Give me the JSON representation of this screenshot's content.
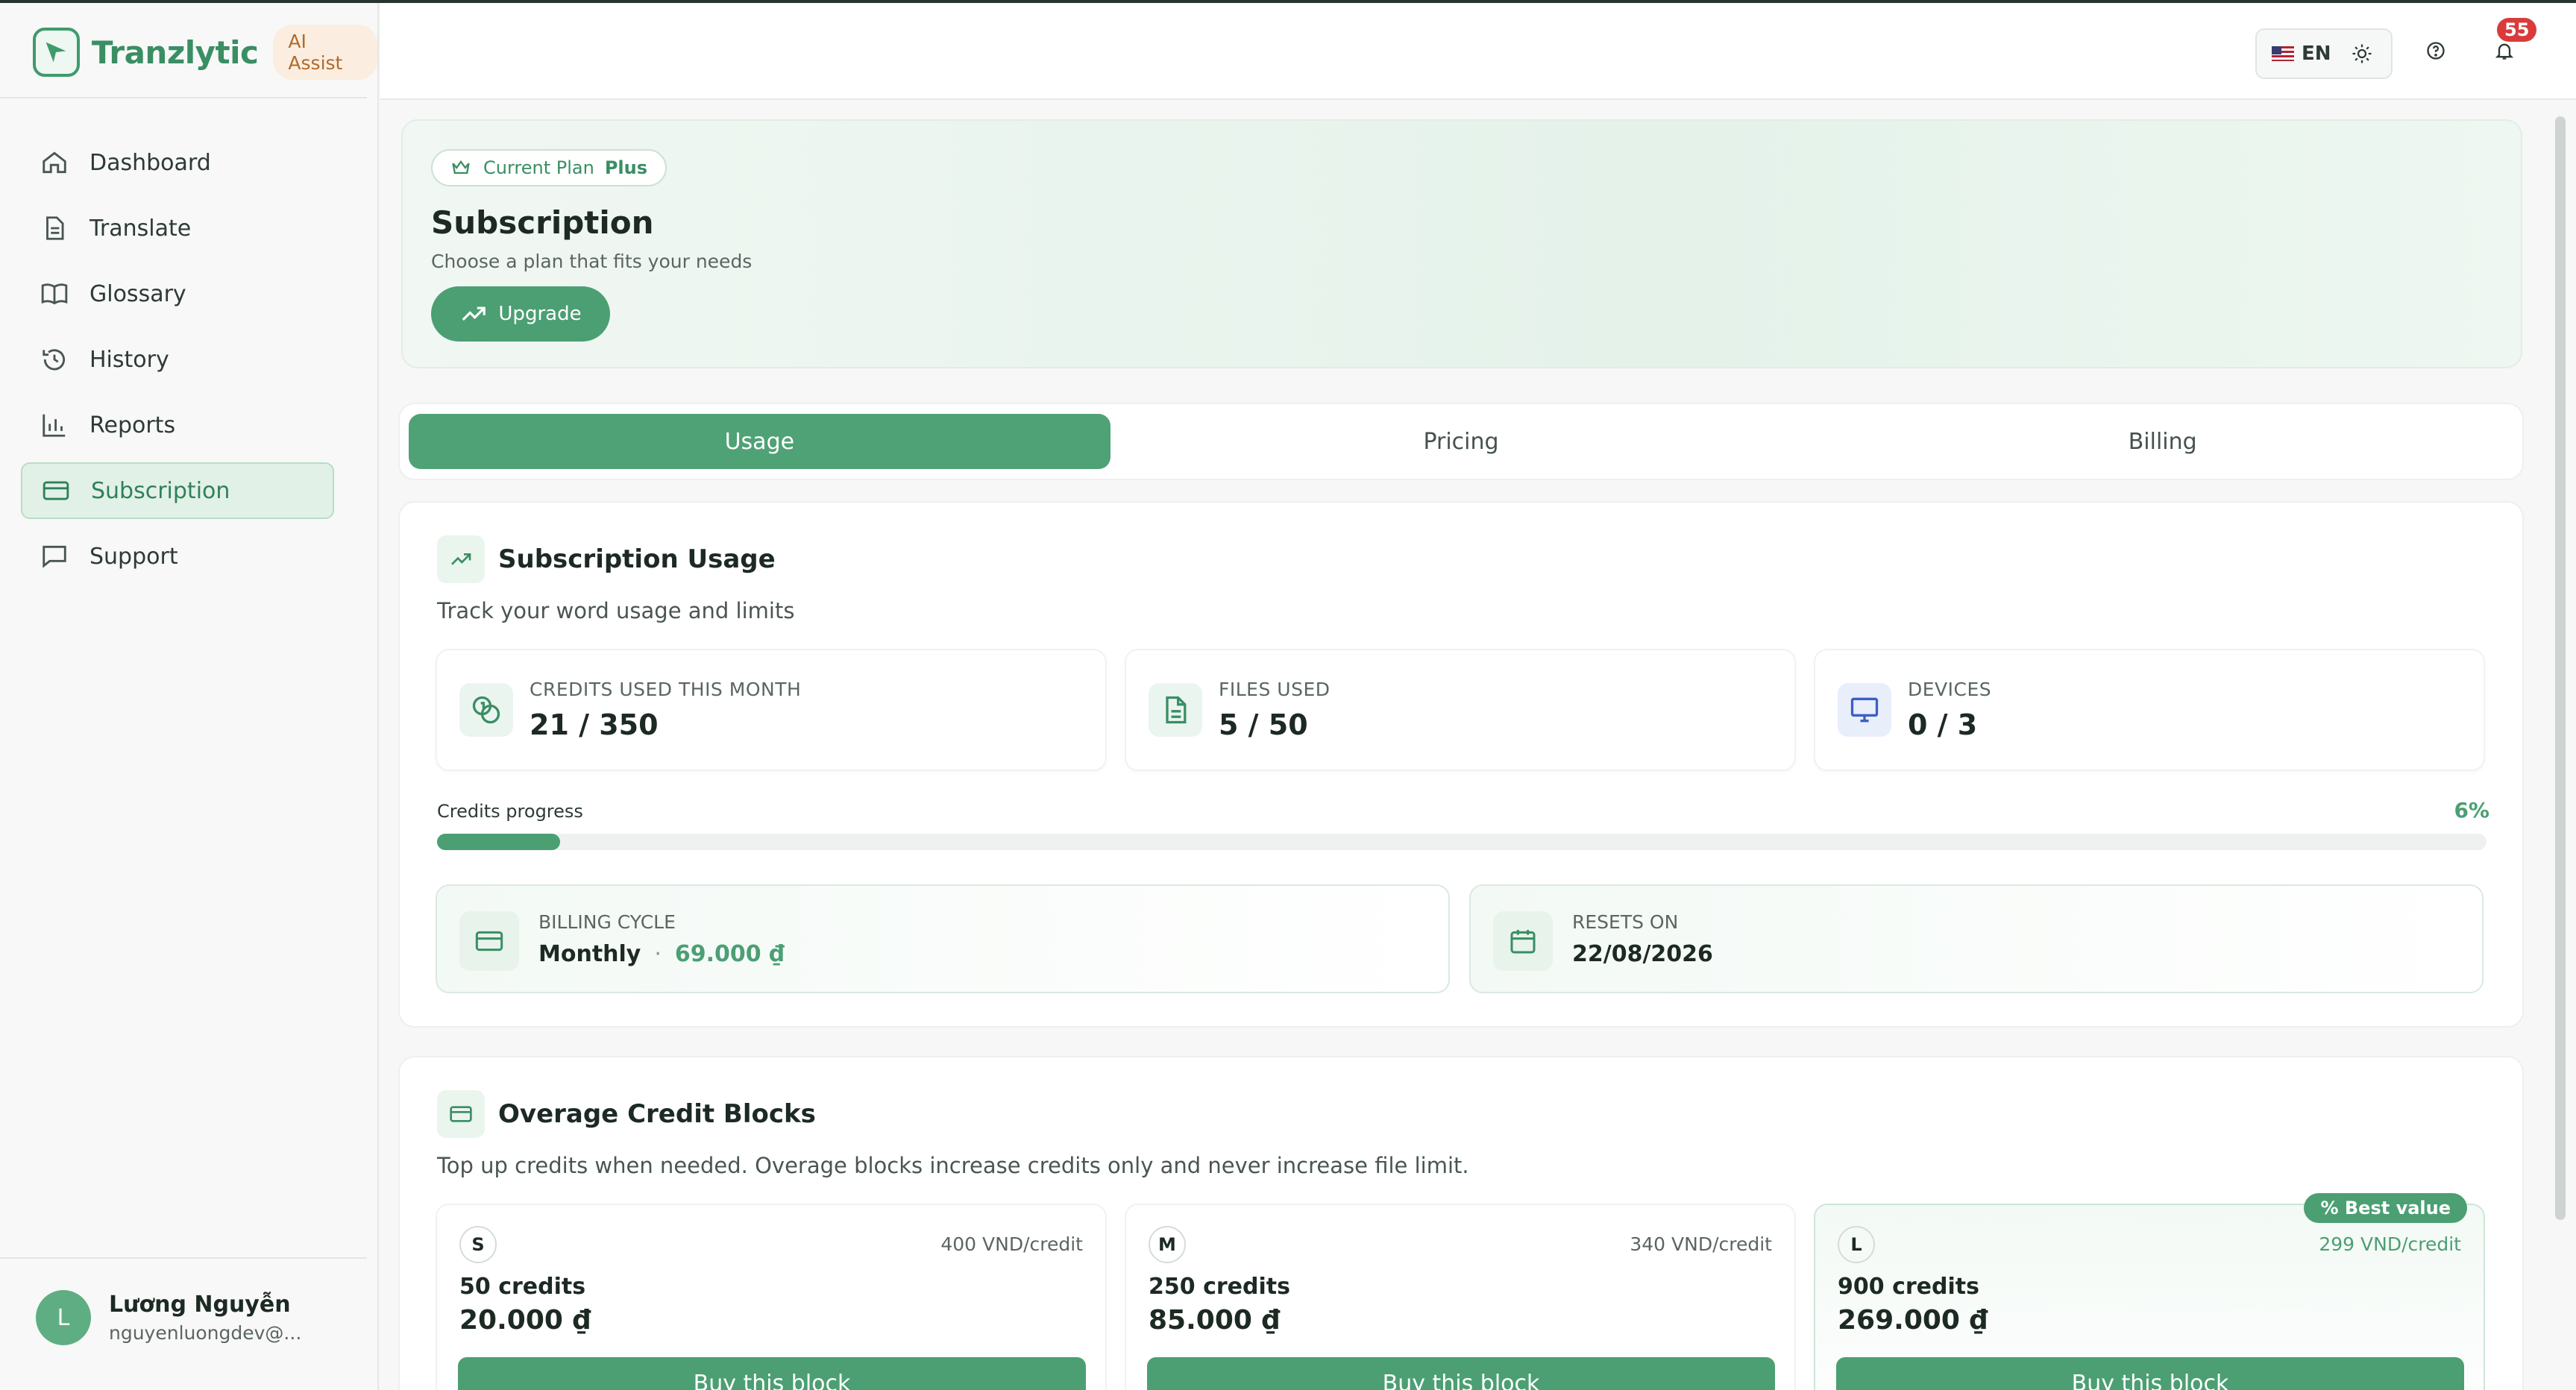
{
  "brand": {
    "name": "Tranzlytic",
    "badge": "AI Assist"
  },
  "sidebar": {
    "items": [
      {
        "label": "Dashboard",
        "icon": "home-icon"
      },
      {
        "label": "Translate",
        "icon": "document-icon"
      },
      {
        "label": "Glossary",
        "icon": "book-icon"
      },
      {
        "label": "History",
        "icon": "history-icon"
      },
      {
        "label": "Reports",
        "icon": "bar-chart-icon"
      },
      {
        "label": "Subscription",
        "icon": "credit-card-icon",
        "active": true
      },
      {
        "label": "Support",
        "icon": "chat-icon"
      }
    ]
  },
  "user": {
    "initial": "L",
    "name": "Lương Nguyễn",
    "email": "nguyenluongdev@..."
  },
  "header": {
    "language": "EN",
    "notifications": "55"
  },
  "hero": {
    "plan_label": "Current Plan",
    "plan_name": "Plus",
    "title": "Subscription",
    "subtitle": "Choose a plan that fits your needs",
    "upgrade": "Upgrade"
  },
  "tabs": [
    {
      "label": "Usage",
      "active": true
    },
    {
      "label": "Pricing"
    },
    {
      "label": "Billing"
    }
  ],
  "usage": {
    "title": "Subscription Usage",
    "subtitle": "Track your word usage and limits",
    "stats": [
      {
        "label": "CREDITS USED THIS MONTH",
        "value": "21 / 350"
      },
      {
        "label": "FILES USED",
        "value": "5 / 50"
      },
      {
        "label": "DEVICES",
        "value": "0 / 3"
      }
    ],
    "progress_label": "Credits progress",
    "progress_text": "6%",
    "progress_fraction": 0.06,
    "billing_cycle_label": "BILLING CYCLE",
    "billing_cycle": "Monthly",
    "billing_dot": "·",
    "billing_price": "69.000 ₫",
    "resets_label": "RESETS ON",
    "resets_on": "22/08/2026"
  },
  "overage": {
    "title": "Overage Credit Blocks",
    "subtitle": "Top up credits when needed. Overage blocks increase credits only and never increase file limit.",
    "blocks": [
      {
        "size": "S",
        "rate": "400 VND/credit",
        "credits": "50 credits",
        "price": "20.000 ₫",
        "button": "Buy this block"
      },
      {
        "size": "M",
        "rate": "340 VND/credit",
        "credits": "250 credits",
        "price": "85.000 ₫",
        "button": "Buy this block"
      },
      {
        "size": "L",
        "rate": "299 VND/credit",
        "credits": "900 credits",
        "price": "269.000 ₫",
        "button": "Buy this block",
        "badge": "% Best value"
      }
    ]
  },
  "colors": {
    "accent": "#4b9f73",
    "brand": "#3a8e64",
    "badge_red": "#d93b3b"
  }
}
